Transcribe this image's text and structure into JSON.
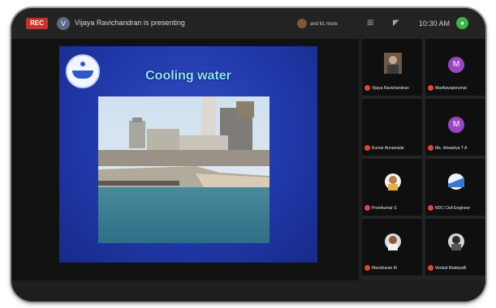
{
  "window": {
    "rec_label": "REC",
    "presenter_initial": "V",
    "presenting_text": "Vijaya Ravichandran is presenting",
    "more_text": "and 61 more",
    "time": "10:30 AM"
  },
  "slide": {
    "title": "Cooling water"
  },
  "participants": [
    {
      "name": "Vijaya Ravichandran"
    },
    {
      "name": "Madhavaperumal",
      "initial": "M"
    },
    {
      "name": "Kumar Annamalai"
    },
    {
      "name": "Ms. Ishwariya T A",
      "initial": "M"
    },
    {
      "name": "Premkumar S"
    },
    {
      "name": "NDC Civil Engineer"
    },
    {
      "name": "Manoharan M"
    },
    {
      "name": "Venkat Madepalli"
    }
  ],
  "colors": {
    "rec": "#c8322c",
    "slide_bg": "#1f37a6",
    "title": "#8fe1ff",
    "avatar": "#9a45c2"
  }
}
